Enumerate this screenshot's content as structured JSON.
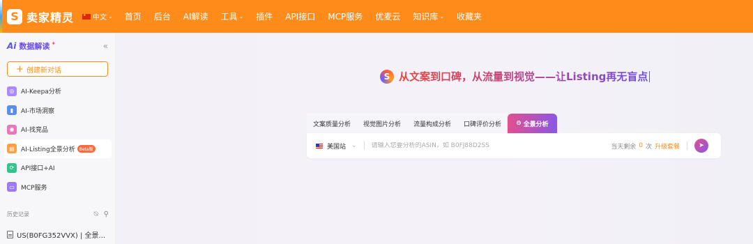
{
  "brand": {
    "logo_glyph": "S",
    "name": "卖家精灵"
  },
  "lang": {
    "label": "中文"
  },
  "nav": [
    {
      "label": "首页",
      "dropdown": false
    },
    {
      "label": "后台",
      "dropdown": false
    },
    {
      "label": "AI解读",
      "dropdown": false
    },
    {
      "label": "工具",
      "dropdown": true
    },
    {
      "label": "插件",
      "dropdown": false
    },
    {
      "label": "API接口",
      "dropdown": false
    },
    {
      "label": "MCP服务",
      "dropdown": false
    },
    {
      "label": "优麦云",
      "dropdown": false
    },
    {
      "label": "知识库",
      "dropdown": true
    },
    {
      "label": "收藏夹",
      "dropdown": false
    }
  ],
  "sidebar": {
    "ai_badge": "Ai",
    "title": "数据解读",
    "collapse_icon": "«",
    "new_chat": "创建新对话",
    "items": [
      {
        "label": "AI-Keepa分析",
        "color": "#a78bfa"
      },
      {
        "label": "AI-市场洞察",
        "color": "#5b8def"
      },
      {
        "label": "AI-找竞品",
        "color": "#e879b9"
      },
      {
        "label": "AI-Listing全景分析",
        "color": "#ff9f43",
        "badge": "Beta版"
      },
      {
        "label": "API接口+AI",
        "color": "#34c38f"
      },
      {
        "label": "MCP服务",
        "color": "#9b7cf0"
      }
    ],
    "history_title": "历史记录",
    "history": [
      {
        "label": "US(B0FG352VVX) | 全景..."
      }
    ]
  },
  "main": {
    "headline": "从文案到口碑，从流量到视觉——让Listing再无盲点",
    "tabs": [
      {
        "label": "文案质量分析"
      },
      {
        "label": "视觉图片分析"
      },
      {
        "label": "流量构成分析"
      },
      {
        "label": "口碑评价分析"
      },
      {
        "label": "全景分析"
      }
    ],
    "search": {
      "site": "美国站",
      "placeholder": "请输入您要分析的ASIN，如 B0FJ88D2SS",
      "quota_prefix": "当天剩余",
      "quota_count": "0",
      "quota_unit": "次",
      "upgrade": "升级套餐"
    }
  }
}
